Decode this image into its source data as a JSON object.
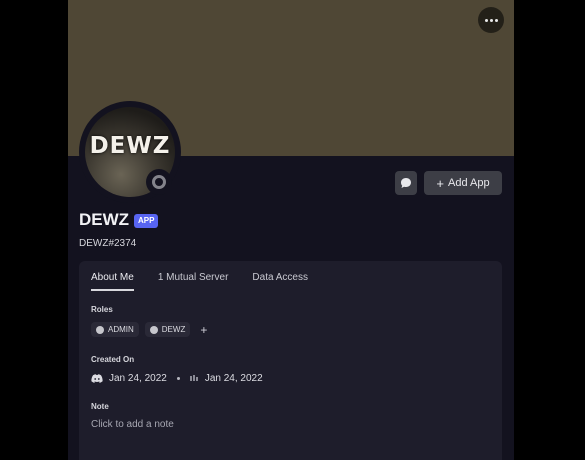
{
  "profile": {
    "avatar_text": "DEWZ",
    "display_name": "DEWZ",
    "badge": "APP",
    "username": "DEWZ#2374"
  },
  "actions": {
    "add_app_label": "Add App"
  },
  "tabs": [
    {
      "label": "About Me",
      "active": true
    },
    {
      "label": "1 Mutual Server",
      "active": false
    },
    {
      "label": "Data Access",
      "active": false
    }
  ],
  "roles": {
    "label": "Roles",
    "items": [
      {
        "name": "ADMIN"
      },
      {
        "name": "DEWZ"
      }
    ],
    "add_symbol": "+"
  },
  "created_on": {
    "label": "Created On",
    "discord_date": "Jan 24, 2022",
    "server_date": "Jan 24, 2022"
  },
  "note": {
    "label": "Note",
    "placeholder": "Click to add a note"
  },
  "colors": {
    "banner": "#4f4735",
    "card_bg": "#13121f",
    "panel_bg": "#1e1d2b",
    "accent": "#5865f2",
    "status_offline": "#83838b"
  },
  "icons": {
    "more": "more-icon",
    "message": "message-icon",
    "discord": "discord-icon",
    "server": "server-icon"
  }
}
